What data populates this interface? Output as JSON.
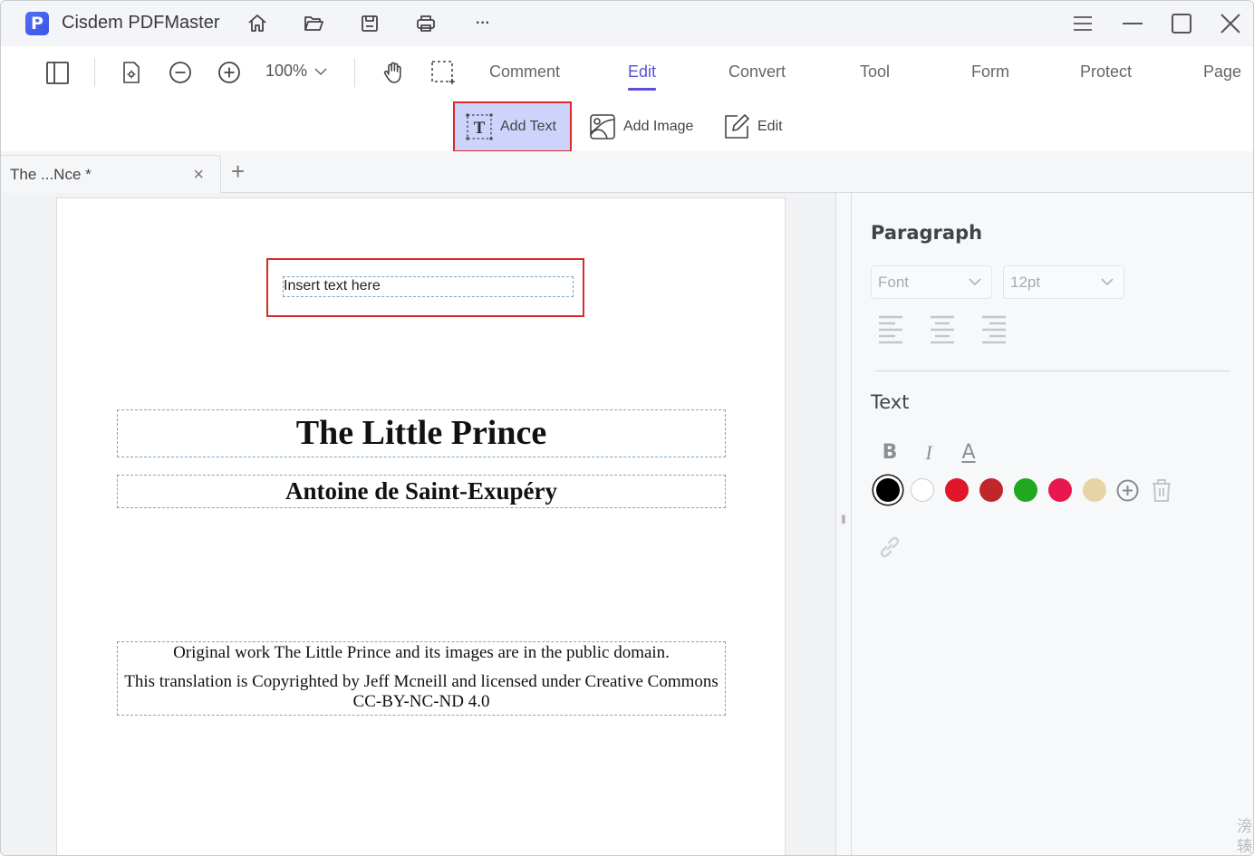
{
  "app": {
    "title": "Cisdem PDFMaster",
    "logo_letter": "P"
  },
  "titlebar": {
    "icons": [
      "home-icon",
      "open-folder-icon",
      "save-icon",
      "print-icon",
      "more-icon"
    ],
    "more_label": "···",
    "window_controls": [
      "menu-icon",
      "minimize-icon",
      "maximize-icon",
      "close-icon"
    ]
  },
  "toolbar": {
    "zoom_level": "100%",
    "tabs": [
      {
        "label": "Comment",
        "active": false
      },
      {
        "label": "Edit",
        "active": true
      },
      {
        "label": "Convert",
        "active": false
      },
      {
        "label": "Tool",
        "active": false
      },
      {
        "label": "Form",
        "active": false
      },
      {
        "label": "Protect",
        "active": false
      },
      {
        "label": "Page",
        "active": false
      }
    ],
    "accent_color": "#5b4fd9"
  },
  "subtoolbar": {
    "add_text": "Add Text",
    "add_image": "Add Image",
    "edit": "Edit"
  },
  "tabs": {
    "document_tab": "The ...Nce *",
    "close": "×",
    "add": "+"
  },
  "document": {
    "insert_placeholder": "Insert text here",
    "title": "The Little Prince",
    "author": "Antoine de Saint-Exupéry",
    "credit_line1": "Original work The Little Prince and its images are in the public domain.",
    "credit_line2": "This translation is Copyrighted by Jeff Mcneill and licensed under Creative Commons",
    "credit_line3": "CC-BY-NC-ND 4.0"
  },
  "splitter": {
    "handle": "II"
  },
  "panel": {
    "paragraph_heading": "Paragraph",
    "font_placeholder": "Font",
    "size_value": "12pt",
    "alignments": [
      "align-left",
      "align-center",
      "align-right"
    ],
    "text_heading": "Text",
    "format": {
      "bold": "B",
      "italic": "I",
      "underline": "A"
    },
    "colors": [
      {
        "name": "black",
        "hex": "#000000",
        "selected": true
      },
      {
        "name": "white",
        "hex": "#ffffff",
        "selected": false
      },
      {
        "name": "red",
        "hex": "#e0162b",
        "selected": false
      },
      {
        "name": "dark-red",
        "hex": "#c0272d",
        "selected": false
      },
      {
        "name": "green",
        "hex": "#20a81f",
        "selected": false
      },
      {
        "name": "crimson",
        "hex": "#e8174d",
        "selected": false
      },
      {
        "name": "beige",
        "hex": "#e6d4a6",
        "selected": false
      }
    ],
    "watermark": "滂 辏"
  }
}
